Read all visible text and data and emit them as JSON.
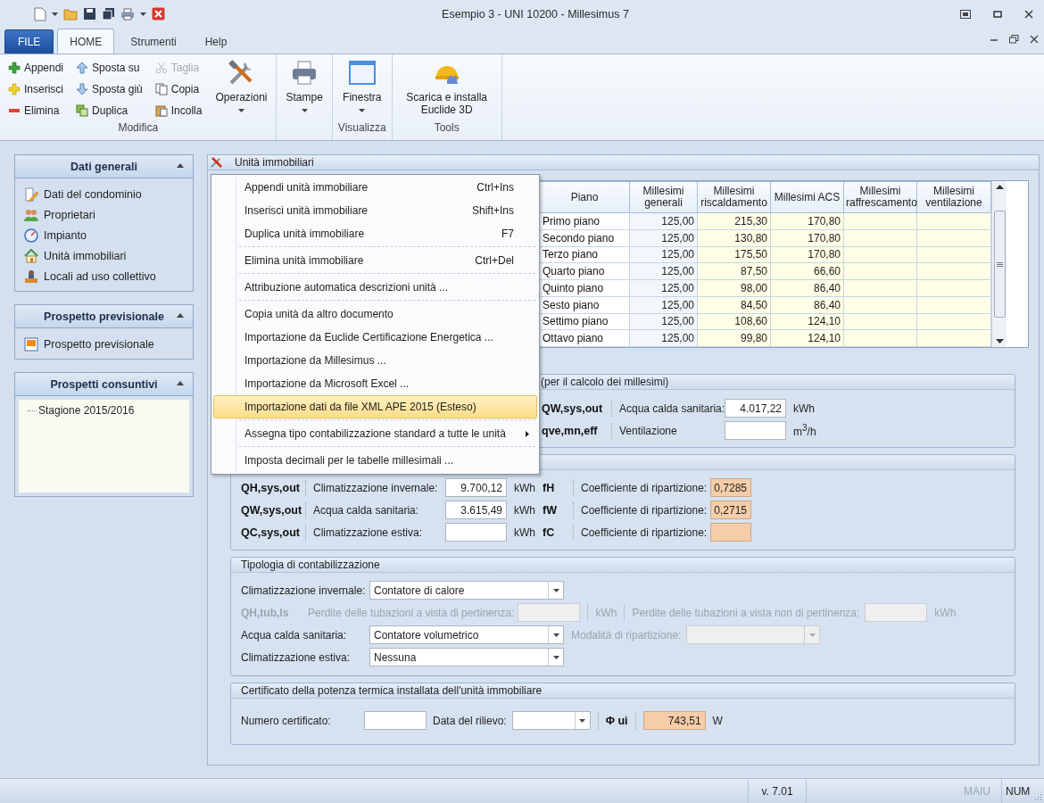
{
  "window": {
    "title": "Esempio 3 - UNI 10200 - Millesimus 7"
  },
  "ribbon": {
    "tabs": [
      {
        "label": "FILE",
        "kind": "file"
      },
      {
        "label": "HOME",
        "kind": "tab",
        "selected": true
      },
      {
        "label": "Strumenti",
        "kind": "tab",
        "selected": false
      },
      {
        "label": "Help",
        "kind": "tab",
        "selected": false
      }
    ],
    "groups": [
      {
        "label": "Modifica",
        "items": [
          {
            "kind": "small",
            "label": "Appendi",
            "disabled": false
          },
          {
            "kind": "small",
            "label": "Inserisci",
            "disabled": false
          },
          {
            "kind": "small",
            "label": "Elimina",
            "disabled": false
          },
          {
            "kind": "small",
            "label": "Sposta su",
            "disabled": false
          },
          {
            "kind": "small",
            "label": "Sposta giù",
            "disabled": false
          },
          {
            "kind": "small",
            "label": "Duplica",
            "disabled": false
          },
          {
            "kind": "small",
            "label": "Taglia",
            "disabled": true
          },
          {
            "kind": "small",
            "label": "Copia",
            "disabled": false
          },
          {
            "kind": "small",
            "label": "Incolla",
            "disabled": false
          },
          {
            "kind": "large",
            "label": "Operazioni",
            "dropdown": true
          }
        ]
      },
      {
        "items": [
          {
            "kind": "large",
            "label": "Stampe",
            "dropdown": true
          }
        ]
      },
      {
        "label": "Visualizza",
        "items": [
          {
            "kind": "large",
            "label": "Finestra",
            "dropdown": true
          }
        ]
      },
      {
        "label": "Tools",
        "items": [
          {
            "kind": "large",
            "label": "Scarica e installa Euclide 3D",
            "dropdown": false
          }
        ]
      }
    ]
  },
  "sidebar": {
    "panels": [
      {
        "title": "Dati generali",
        "expanded": true,
        "kind": "list",
        "items": [
          {
            "label": "Dati del condominio"
          },
          {
            "label": "Proprietari"
          },
          {
            "label": "Impianto"
          },
          {
            "label": "Unità immobiliari"
          },
          {
            "label": "Locali ad uso collettivo"
          }
        ]
      },
      {
        "title": "Prospetto previsionale",
        "expanded": true,
        "kind": "list",
        "items": [
          {
            "label": "Prospetto previsionale"
          }
        ]
      },
      {
        "title": "Prospetti consuntivi",
        "expanded": true,
        "kind": "tree",
        "items": [
          {
            "label": "Stagione 2015/2016"
          }
        ]
      }
    ]
  },
  "document": {
    "title": "Unità immobiliari",
    "table": {
      "columns": [
        "Piano",
        "Millesimi generali",
        "Millesimi riscaldamento",
        "Millesimi ACS",
        "Millesimi raffrescamento",
        "Millesimi ventilazione"
      ],
      "rows": [
        [
          "Primo piano",
          "125,00",
          "215,30",
          "170,80",
          "",
          ""
        ],
        [
          "Secondo piano",
          "125,00",
          "130,80",
          "170,80",
          "",
          ""
        ],
        [
          "Terzo piano",
          "125,00",
          "175,50",
          "170,80",
          "",
          ""
        ],
        [
          "Quarto piano",
          "125,00",
          "87,50",
          "66,60",
          "",
          ""
        ],
        [
          "Quinto piano",
          "125,00",
          "98,00",
          "86,40",
          "",
          ""
        ],
        [
          "Sesto piano",
          "125,00",
          "84,50",
          "86,40",
          "",
          ""
        ],
        [
          "Settimo piano",
          "125,00",
          "108,60",
          "124,10",
          "",
          ""
        ],
        [
          "Ottavo piano",
          "125,00",
          "99,80",
          "124,10",
          "",
          ""
        ]
      ]
    },
    "sections": [
      {
        "kind": "needs",
        "title": "(per il calcolo dei millesimi)",
        "rows": [
          {
            "symbol": "QW,sys,out",
            "label": "Acqua calda sanitaria:",
            "value": "4.017,22",
            "unit": "kWh"
          },
          {
            "symbol": "qve,mn,eff",
            "label": "Ventilazione",
            "unit": "m$^{3}$/h"
          }
        ]
      },
      {
        "kind": "split",
        "rows": [
          {
            "symbol": "QH,sys,out",
            "label": "Climatizzazione invernale:",
            "value": "9.700,12",
            "unit": "kWh",
            "coef_symbol": "fH",
            "coef_label": "Coefficiente di ripartizione:",
            "coef_value": "0,7285"
          },
          {
            "symbol": "QW,sys,out",
            "label": "Acqua calda sanitaria:",
            "value": "3.615,49",
            "unit": "kWh",
            "coef_symbol": "fW",
            "coef_label": "Coefficiente di ripartizione:",
            "coef_value": "0,2715"
          },
          {
            "symbol": "QC,sys,out",
            "label": "Climatizzazione estiva:",
            "unit": "kWh",
            "coef_symbol": "fC",
            "coef_label": "Coefficiente di ripartizione:"
          }
        ]
      },
      {
        "kind": "metering",
        "title": "Tipologia di contabilizzazione",
        "rows": [
          {
            "kind": "select",
            "label": "Climatizzazione invernale:",
            "value": "Contatore di calore"
          },
          {
            "kind": "losses",
            "disabled": true,
            "symbol": "QH,tub,ls",
            "label": "Perdite delle tubazioni a vista di pertinenza:",
            "unit": "kWh",
            "label_2": "Perdite delle tubazioni a vista non di pertinenza:",
            "unit_2": "kWh"
          },
          {
            "kind": "select",
            "label": "Acqua calda sanitaria:",
            "value": "Contatore volumetrico",
            "extra": {
              "label": "Modalità di ripartizione:",
              "disabled": true
            }
          },
          {
            "kind": "select",
            "label": "Climatizzazione estiva:",
            "value": "Nessuna"
          }
        ]
      },
      {
        "kind": "certificate",
        "title": "Certificato della potenza termica installata dell'unità immobiliare",
        "number_label": "Numero certificato:",
        "date_label": "Data del rilievo:",
        "symbol": "Φ ui",
        "value": "743,51",
        "unit": "W"
      }
    ]
  },
  "context_menu": {
    "groups": [
      [
        {
          "label": "Appendi unità immobiliare",
          "shortcut": "Ctrl+Ins",
          "selected": false
        },
        {
          "label": "Inserisci unità immobiliare",
          "shortcut": "Shift+Ins",
          "selected": false
        },
        {
          "label": "Duplica unità immobiliare",
          "shortcut": "F7",
          "selected": false
        }
      ],
      [
        {
          "label": "Elimina unità immobiliare",
          "shortcut": "Ctrl+Del",
          "selected": false
        }
      ],
      [
        {
          "label": "Attribuzione automatica descrizioni unità ...",
          "selected": false
        }
      ],
      [
        {
          "label": "Copia unità da altro documento",
          "selected": false
        },
        {
          "label": "Importazione da Euclide Certificazione Energetica ...",
          "selected": false
        },
        {
          "label": "Importazione da Millesimus ...",
          "selected": false
        },
        {
          "label": "Importazione da Microsoft Excel ...",
          "selected": false
        },
        {
          "label": "Importazione dati da file XML APE 2015 (Esteso)",
          "selected": true
        }
      ],
      [
        {
          "label": "Assegna tipo contabilizzazione standard a tutte le unità",
          "selected": false,
          "submenu": true
        }
      ],
      [
        {
          "label": "Imposta decimali per le tabelle millesimali ...",
          "selected": false
        }
      ]
    ]
  },
  "status_bar": [
    {
      "label": "v. 7.01",
      "disabled": false
    },
    {
      "label": "MAIU",
      "disabled": true
    },
    {
      "label": "NUM",
      "disabled": false
    }
  ]
}
